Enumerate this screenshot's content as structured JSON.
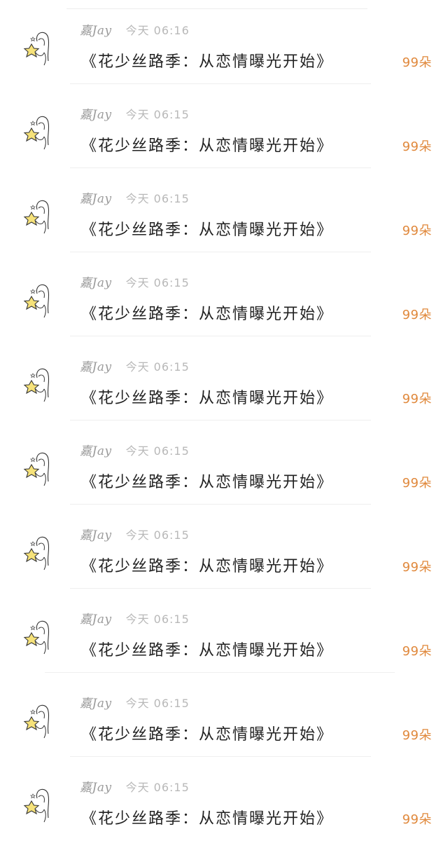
{
  "items": [
    {
      "user": "嘉Jay",
      "time": "今天 06:16",
      "title": "《花少丝路季：从恋情曝光开始》",
      "amount": "99朵"
    },
    {
      "user": "嘉Jay",
      "time": "今天 06:15",
      "title": "《花少丝路季：从恋情曝光开始》",
      "amount": "99朵"
    },
    {
      "user": "嘉Jay",
      "time": "今天 06:15",
      "title": "《花少丝路季：从恋情曝光开始》",
      "amount": "99朵"
    },
    {
      "user": "嘉Jay",
      "time": "今天 06:15",
      "title": "《花少丝路季：从恋情曝光开始》",
      "amount": "99朵"
    },
    {
      "user": "嘉Jay",
      "time": "今天 06:15",
      "title": "《花少丝路季：从恋情曝光开始》",
      "amount": "99朵"
    },
    {
      "user": "嘉Jay",
      "time": "今天 06:15",
      "title": "《花少丝路季：从恋情曝光开始》",
      "amount": "99朵"
    },
    {
      "user": "嘉Jay",
      "time": "今天 06:15",
      "title": "《花少丝路季：从恋情曝光开始》",
      "amount": "99朵"
    },
    {
      "user": "嘉Jay",
      "time": "今天 06:15",
      "title": "《花少丝路季：从恋情曝光开始》",
      "amount": "99朵"
    },
    {
      "user": "嘉Jay",
      "time": "今天 06:15",
      "title": "《花少丝路季：从恋情曝光开始》",
      "amount": "99朵"
    },
    {
      "user": "嘉Jay",
      "time": "今天 06:15",
      "title": "《花少丝路季：从恋情曝光开始》",
      "amount": "99朵"
    }
  ],
  "avatar": {
    "icon": "girl-with-star-avatar-icon",
    "star_color": "#f6e27a",
    "line_color": "#333333"
  },
  "colors": {
    "amount": "#e0883b",
    "meta": "#9a9a9a",
    "title": "#222222"
  }
}
